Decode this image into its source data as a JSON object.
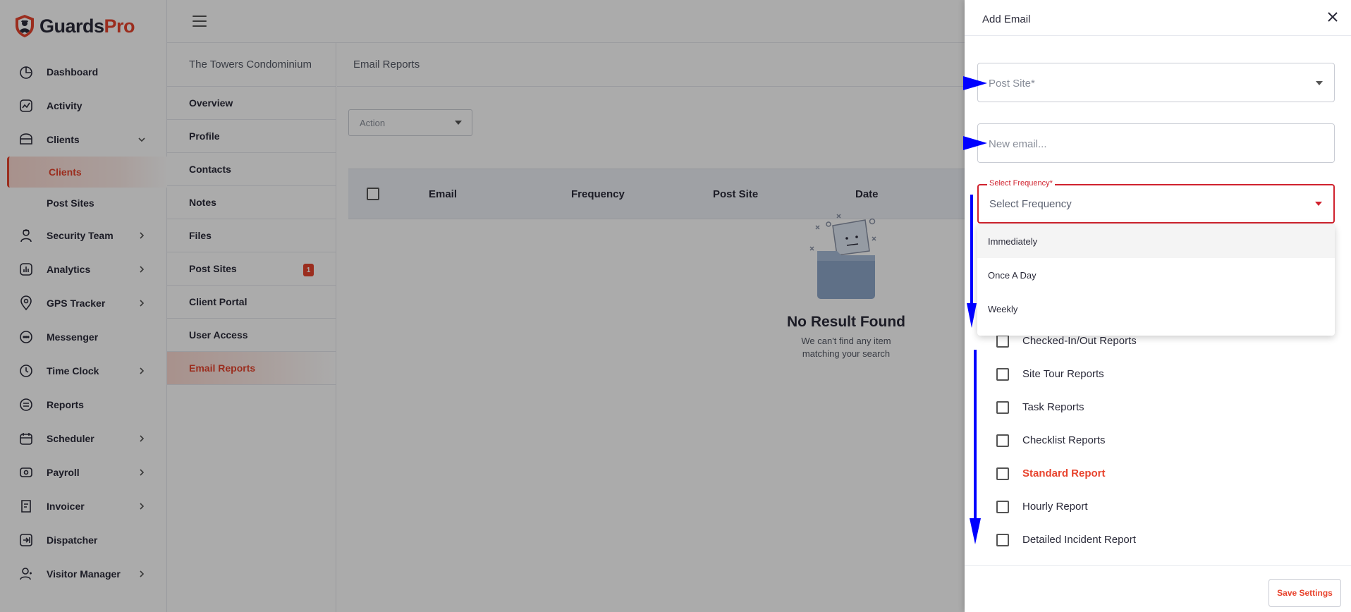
{
  "brand": {
    "name_main": "Guards",
    "name_accent": "Pro",
    "accent_color": "#e8442e"
  },
  "sidebar": {
    "items": [
      {
        "label": "Dashboard",
        "icon": "dashboard-icon",
        "has_children": false
      },
      {
        "label": "Activity",
        "icon": "activity-icon",
        "has_children": false
      },
      {
        "label": "Clients",
        "icon": "clients-icon",
        "has_children": true,
        "expanded": true,
        "children": [
          {
            "label": "Clients",
            "active": true
          },
          {
            "label": "Post Sites",
            "active": false
          }
        ]
      },
      {
        "label": "Security Team",
        "icon": "security-team-icon",
        "has_children": true
      },
      {
        "label": "Analytics",
        "icon": "analytics-icon",
        "has_children": true
      },
      {
        "label": "GPS Tracker",
        "icon": "gps-icon",
        "has_children": true
      },
      {
        "label": "Messenger",
        "icon": "messenger-icon",
        "has_children": false
      },
      {
        "label": "Time Clock",
        "icon": "clock-icon",
        "has_children": true
      },
      {
        "label": "Reports",
        "icon": "reports-icon",
        "has_children": false
      },
      {
        "label": "Scheduler",
        "icon": "calendar-icon",
        "has_children": true
      },
      {
        "label": "Payroll",
        "icon": "payroll-icon",
        "has_children": true
      },
      {
        "label": "Invoicer",
        "icon": "invoice-icon",
        "has_children": true
      },
      {
        "label": "Dispatcher",
        "icon": "dispatcher-icon",
        "has_children": false
      },
      {
        "label": "Visitor Manager",
        "icon": "visitor-icon",
        "has_children": true
      }
    ]
  },
  "subnav": {
    "title": "The Towers Condominium",
    "items": [
      {
        "label": "Overview",
        "active": false,
        "badge": ""
      },
      {
        "label": "Profile",
        "active": false,
        "badge": ""
      },
      {
        "label": "Contacts",
        "active": false,
        "badge": ""
      },
      {
        "label": "Notes",
        "active": false,
        "badge": ""
      },
      {
        "label": "Files",
        "active": false,
        "badge": ""
      },
      {
        "label": "Post Sites",
        "active": false,
        "badge": "1"
      },
      {
        "label": "Client Portal",
        "active": false,
        "badge": ""
      },
      {
        "label": "User Access",
        "active": false,
        "badge": ""
      },
      {
        "label": "Email Reports",
        "active": true,
        "badge": ""
      }
    ]
  },
  "main": {
    "title": "Email Reports",
    "action_placeholder": "Action",
    "columns": [
      "Email",
      "Frequency",
      "Post Site",
      "Date"
    ],
    "empty_title": "No Result Found",
    "empty_subtitle": "We can't find any item matching your search"
  },
  "drawer": {
    "title": "Add Email",
    "post_site_placeholder": "Post Site*",
    "email_placeholder": "New email...",
    "frequency_label": "Select Frequency*",
    "frequency_placeholder": "Select Frequency",
    "frequency_options": [
      "Immediately",
      "Once A Day",
      "Weekly"
    ],
    "report_types": [
      {
        "label": "Checked-In/Out Reports",
        "highlight": false
      },
      {
        "label": "Site Tour Reports",
        "highlight": false
      },
      {
        "label": "Task Reports",
        "highlight": false
      },
      {
        "label": "Checklist Reports",
        "highlight": false
      },
      {
        "label": "Standard Report",
        "highlight": true
      },
      {
        "label": "Hourly Report",
        "highlight": false
      },
      {
        "label": "Detailed Incident Report",
        "highlight": false
      }
    ],
    "save_label": "Save Settings"
  },
  "colors": {
    "error": "#d0222e",
    "annotation_arrow": "#0000ff"
  }
}
